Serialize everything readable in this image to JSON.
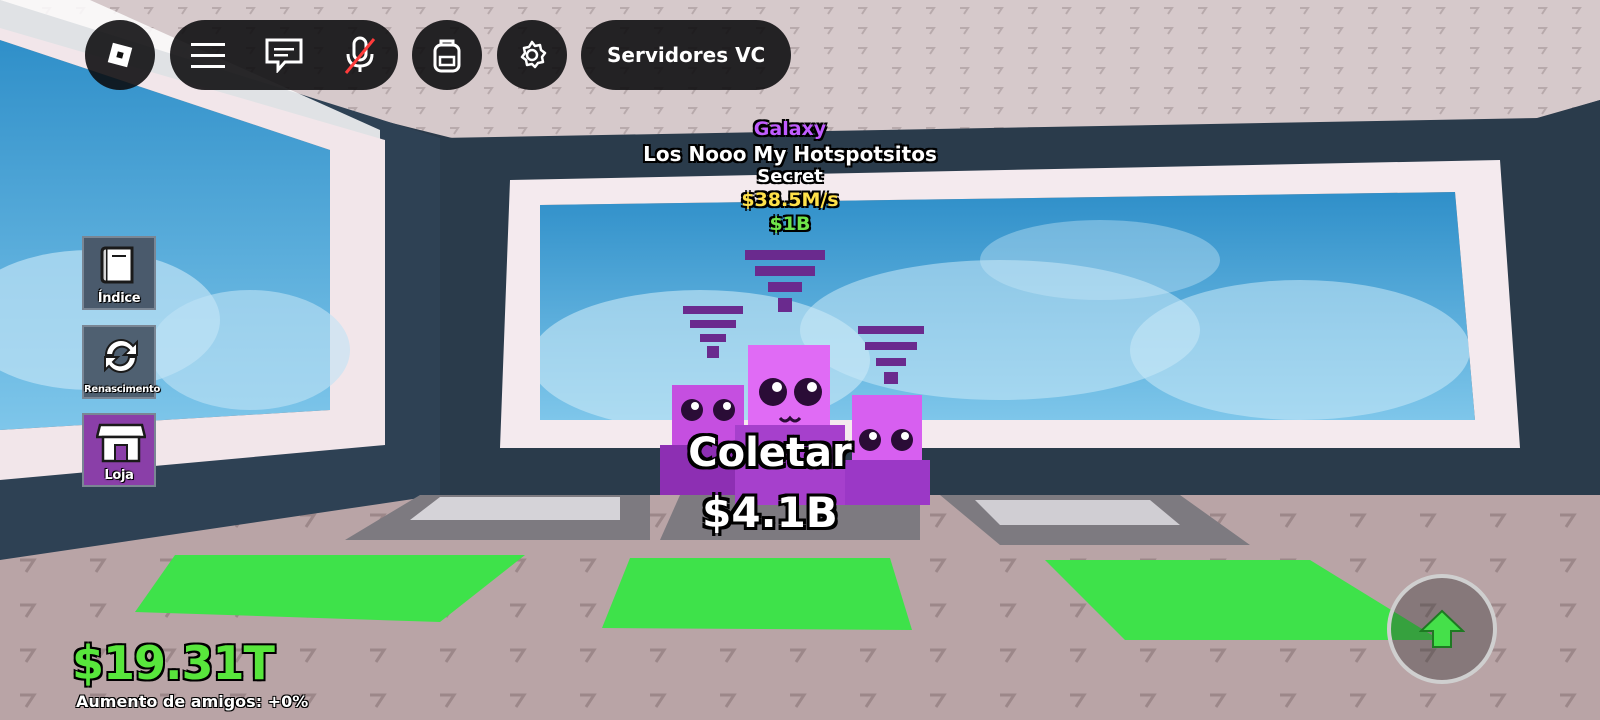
{
  "topbar": {
    "servers_label": "Servidores VC"
  },
  "sidebar": {
    "items": [
      {
        "label": "Índice",
        "icon": "book-icon"
      },
      {
        "label": "Renascimento",
        "icon": "rebirth-icon"
      },
      {
        "label": "Loja",
        "icon": "shop-icon"
      }
    ]
  },
  "pet": {
    "rarity": "Galaxy",
    "name": "Los Nooo My Hotspotsitos",
    "tier": "Secret",
    "rate": "$38.5M/s",
    "price": "$1B"
  },
  "collect": {
    "label": "Coletar",
    "amount": "$4.1B"
  },
  "hud": {
    "money": "$19.31T",
    "friend_boost": "Aumento de amigos: +0%"
  },
  "colors": {
    "money": "#58e63c",
    "rarity": "#c15cff",
    "rate": "#ffe14a",
    "price": "#6fe44a",
    "pad_green": "#3ee24a",
    "pet_pink": "#e06bf5"
  }
}
